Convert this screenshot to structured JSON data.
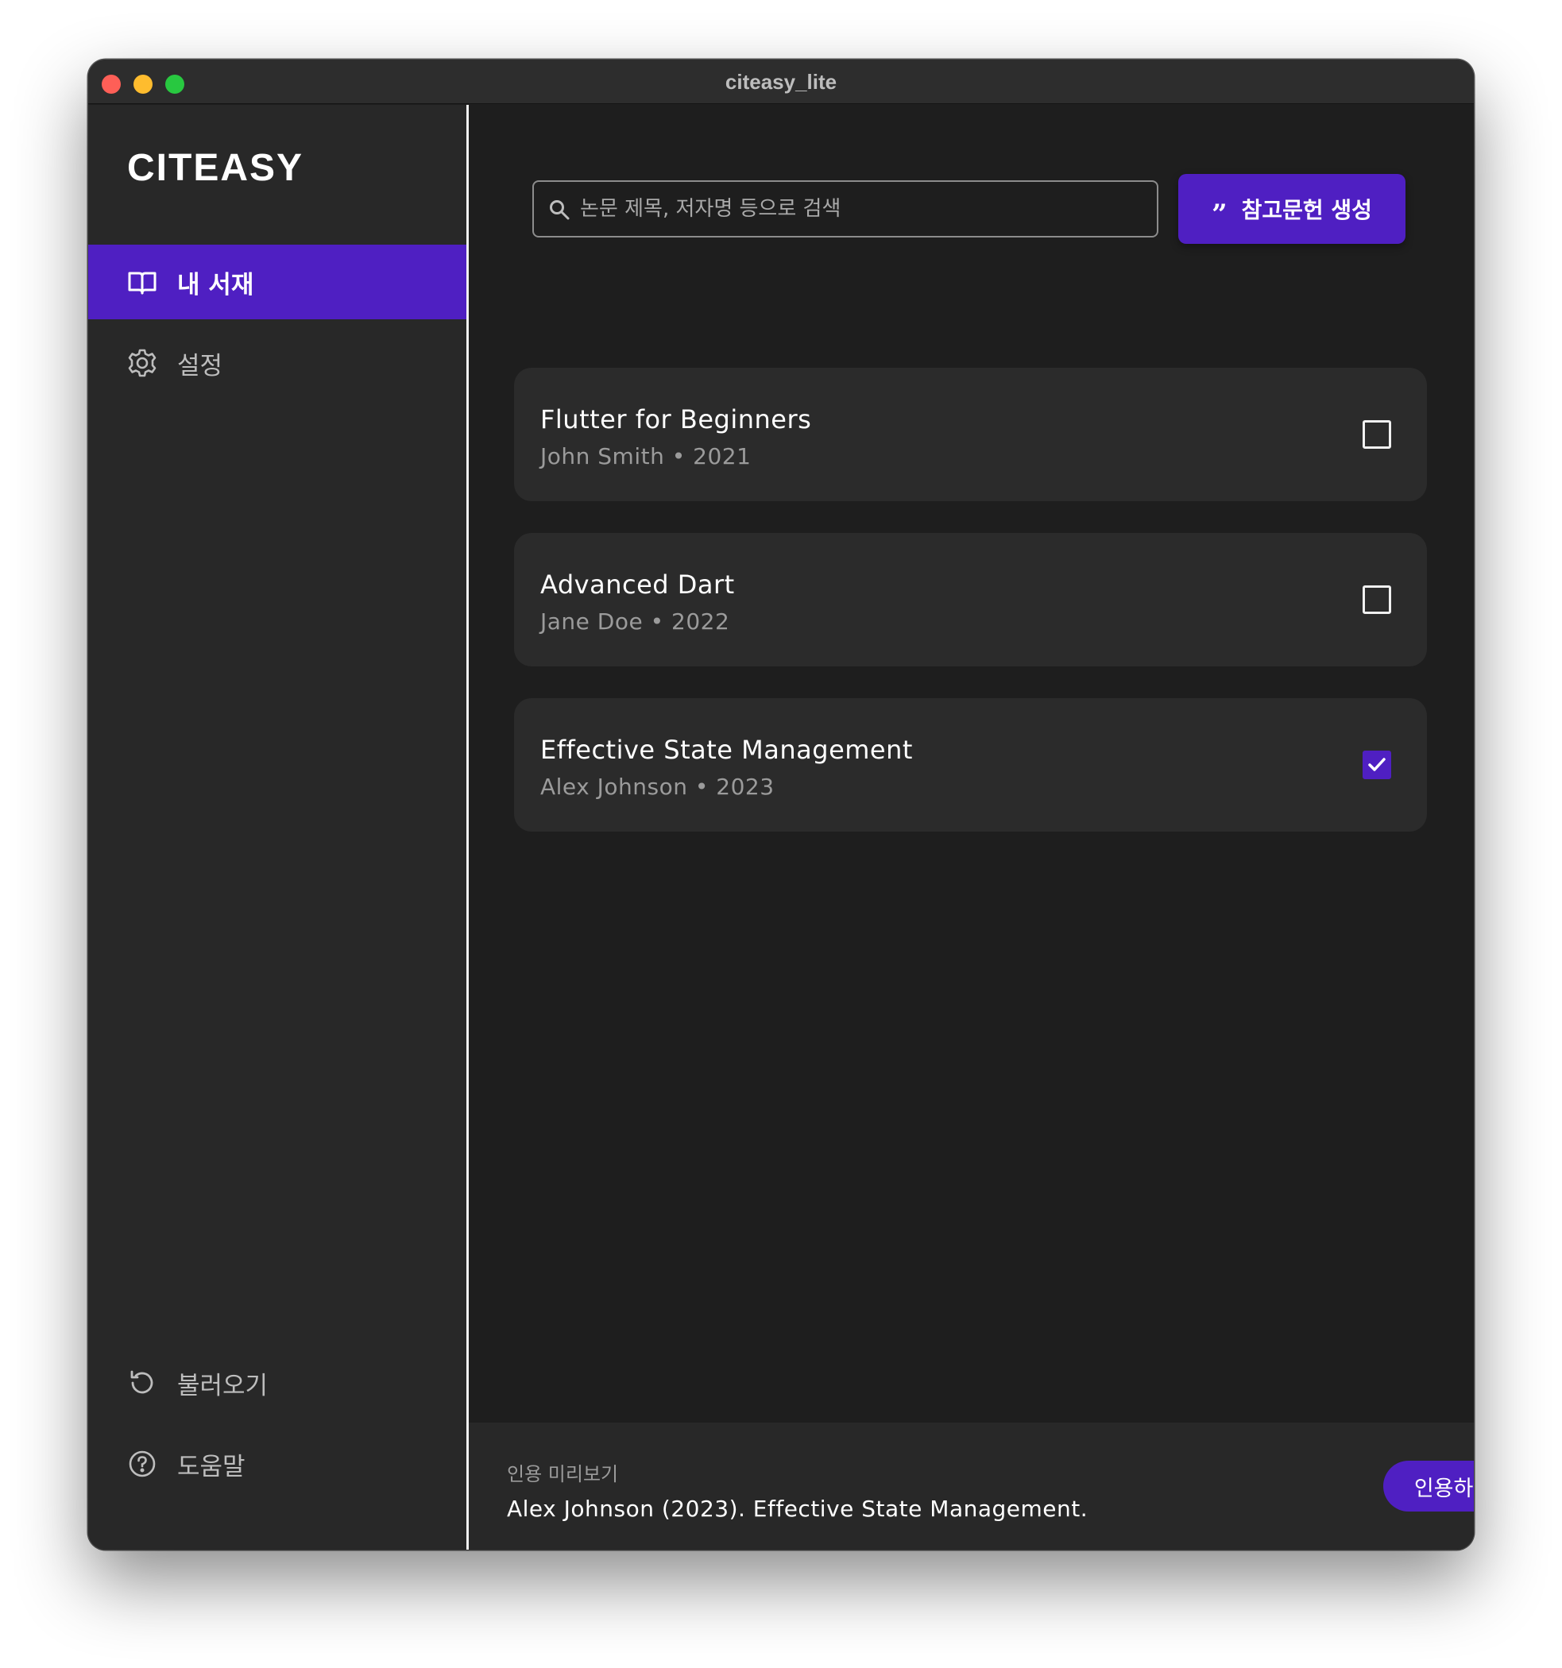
{
  "window": {
    "title": "citeasy_lite"
  },
  "sidebar": {
    "brand": "CITEASY",
    "items": [
      {
        "label": "내 서재",
        "icon": "book-icon",
        "active": true
      },
      {
        "label": "설정",
        "icon": "gear-icon",
        "active": false
      }
    ],
    "bottom_items": [
      {
        "label": "불러오기",
        "icon": "refresh-icon"
      },
      {
        "label": "도움말",
        "icon": "help-icon"
      }
    ]
  },
  "search": {
    "placeholder": "논문 제목, 저자명 등으로 검색",
    "value": ""
  },
  "generate_button": {
    "label": "참고문헌 생성",
    "icon": "quote-icon"
  },
  "papers": [
    {
      "title": "Flutter for Beginners",
      "meta": "John Smith • 2021",
      "checked": false
    },
    {
      "title": "Advanced Dart",
      "meta": "Jane Doe • 2022",
      "checked": false
    },
    {
      "title": "Effective State Management",
      "meta": "Alex Johnson • 2023",
      "checked": true
    }
  ],
  "preview": {
    "label": "인용 미리보기",
    "text": "Alex Johnson (2023). Effective State Management.",
    "button_label": "인용하기"
  },
  "colors": {
    "accent": "#4f1fc2",
    "background": "#1e1e1e",
    "sidebar": "#282828",
    "card": "#2b2b2b"
  }
}
